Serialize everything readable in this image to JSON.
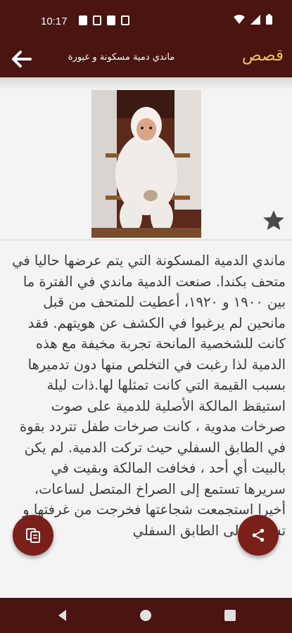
{
  "status_bar": {
    "time": "10:17",
    "icons_left": [
      "youtube-icon",
      "photo-icon",
      "sim-icon",
      "storage-icon"
    ],
    "icons_right": [
      "wifi-icon",
      "signal-icon",
      "battery-icon"
    ]
  },
  "app_bar": {
    "title": "ماندي دمية مسكونة و غيورة",
    "brand": "قصص",
    "back_icon": "arrow-back-icon"
  },
  "story": {
    "image_icon": "doll-photo",
    "favorite_icon": "star-icon",
    "text": "ماندي الدمية المسكونة التي يتم عرضها حاليا في متحف بكندا. صنعت الدمية ماندي في الفترة ما بين ١٩٠٠ و ١٩٢٠، أعطيت للمتحف من قبل مانحين لم يرغبوا في الكشف عن هويتهم. فقد كانت للشخصية المانحة تجربة مخيفة مع هذه الدمية لذا رغبت في التخلص منها دون تدميرها بسبب القيمة التي كانت تمثلها لها.ذات ليلة استيقظ المالكة الأصلية للدمية على صوت صرخات مدوية ، كانت صرخات طفل تتردد بقوة في الطابق السفلي حيث تركت الدمية. لم يكن بالبيت أي أحد ، فخافت المالكة وبقيت في سريرها تستمع إلى الصراخ المتصل لساعات، أخيرا استجمعت شجاعتها فخرجت من غرفتها و تسللت إلى الطابق السفلي"
  },
  "actions": {
    "copy_icon": "copy-icon",
    "share_icon": "share-icon"
  },
  "nav_bar": {
    "back": "nav-back-icon",
    "home": "nav-home-icon",
    "recents": "nav-recents-icon"
  },
  "colors": {
    "bar": "#4a1410",
    "brand": "#e8c060",
    "fab": "#7a1f1a",
    "background": "#f4f4f4",
    "text": "#3a3a3a"
  }
}
